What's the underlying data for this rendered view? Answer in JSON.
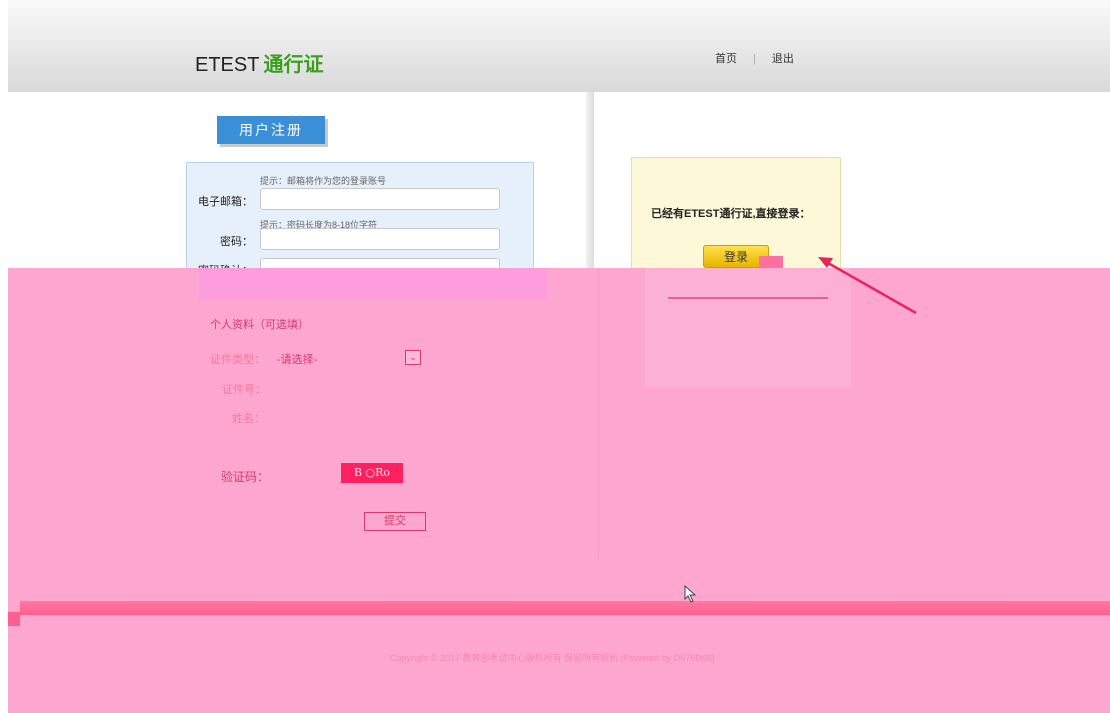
{
  "header": {
    "logo_prefix": "ETEST",
    "logo_brand": "通行证",
    "nav": {
      "home": "首页",
      "separator": "|",
      "logout": "退出"
    }
  },
  "register": {
    "tab_label": "用户注册",
    "email_hint": "提示：邮箱将作为您的登录账号",
    "email_label": "电子邮箱：",
    "password_hint": "提示：密码长度为8-18位字符",
    "password_label": "密码：",
    "confirm_label": "密码确认：",
    "personal_title": "个人资料（可选填）",
    "id_type_label": "证件类型：",
    "id_type_selected": "-请选择-",
    "id_number_label": "证件号：",
    "name_label": "姓名：",
    "captcha_label": "验证码：",
    "captcha_text": "B ○Ro",
    "submit_label": "提交"
  },
  "login": {
    "prompt": "已经有ETEST通行证,直接登录：",
    "button_label": "登录"
  },
  "footer": {
    "copyright": "Copyright © 2017 教育部考试中心版权所有 保留所有权利 (Powered by D676D68)"
  },
  "colors": {
    "brand_green": "#3a9e1f",
    "tab_blue": "#3b8fd6",
    "login_yellow": "#ffe14a",
    "overlay_pink": "#fda7d0",
    "annotation_red": "#e8245a"
  }
}
